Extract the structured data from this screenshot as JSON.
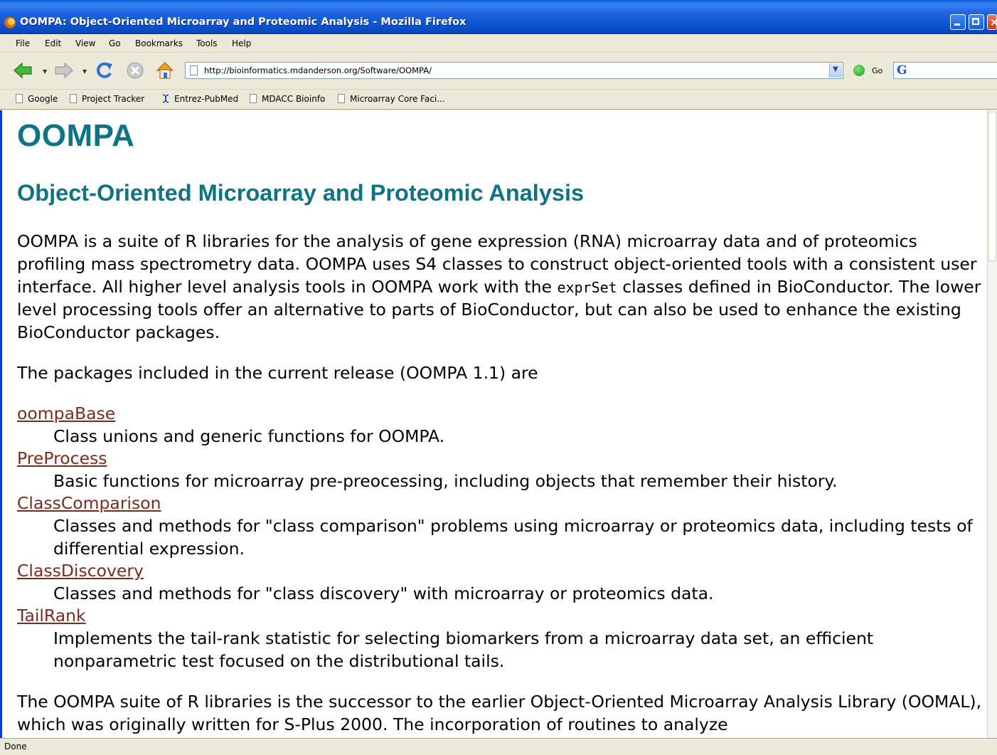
{
  "window": {
    "title": "OOMPA: Object-Oriented Microarray and Proteomic Analysis - Mozilla Firefox"
  },
  "menu": {
    "file": "File",
    "edit": "Edit",
    "view": "View",
    "go": "Go",
    "bookmarks": "Bookmarks",
    "tools": "Tools",
    "help": "Help"
  },
  "nav": {
    "url": "http://bioinformatics.mdanderson.org/Software/OOMPA/",
    "go_label": "Go",
    "search_engine_glyph": "G"
  },
  "bookmarks": [
    {
      "label": "Google",
      "icon": "page-icon"
    },
    {
      "label": "Project Tracker",
      "icon": "page-icon"
    },
    {
      "label": "Entrez-PubMed",
      "icon": "dna-icon"
    },
    {
      "label": "MDACC Bioinfo",
      "icon": "page-icon"
    },
    {
      "label": "Microarray Core Faci...",
      "icon": "page-icon"
    }
  ],
  "page": {
    "title": "OOMPA",
    "subtitle": "Object-Oriented Microarray and Proteomic Analysis",
    "intro_before_code": "OOMPA is a suite of R libraries for the analysis of gene expression (RNA) microarray data and of proteomics profiling mass spectrometry data. OOMPA uses S4 classes to construct object-oriented tools with a consistent user interface. All higher level analysis tools in OOMPA work with the ",
    "intro_code": "exprSet",
    "intro_after_code": " classes defined in BioConductor. The lower level processing tools offer an alternative to parts of BioConductor, but can also be used to enhance the existing BioConductor packages.",
    "packages_intro": "The packages included in the current release (OOMPA 1.1) are",
    "packages": [
      {
        "name": "oompaBase",
        "desc": "Class unions and generic functions for OOMPA."
      },
      {
        "name": "PreProcess",
        "desc": "Basic functions for microarray pre-preocessing, including objects that remember their history."
      },
      {
        "name": "ClassComparison",
        "desc": "Classes and methods for \"class comparison\" problems using microarray or proteomics data, including tests of differential expression."
      },
      {
        "name": "ClassDiscovery",
        "desc": "Classes and methods for \"class discovery\" with microarray or proteomics data."
      },
      {
        "name": "TailRank",
        "desc": "Implements the tail-rank statistic for selecting biomarkers from a microarray data set, an efficient nonparametric test focused on the distributional tails."
      }
    ],
    "outro": "The OOMPA suite of R libraries is the successor to the earlier Object-Oriented Microarray Analysis Library (OOMAL), which was originally written for S-Plus 2000. The incorporation of routines to analyze"
  },
  "status": {
    "text": "Done"
  },
  "colors": {
    "heading": "#0e7384",
    "link": "#7b2a1e",
    "titlebar": "#0a4fc8",
    "chrome": "#ece9d8"
  }
}
